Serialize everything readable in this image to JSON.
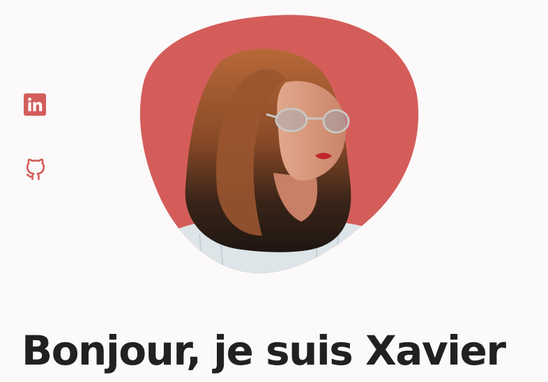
{
  "social": {
    "links": [
      {
        "name": "linkedin",
        "icon": "linkedin-icon"
      },
      {
        "name": "github",
        "icon": "github-icon"
      }
    ],
    "accent_color": "#d45d5a"
  },
  "hero": {
    "title": "Bonjour, je suis Xavier",
    "image_alt": "portrait-photo"
  },
  "colors": {
    "background": "#fcf9fa",
    "accent": "#d45d5a",
    "text": "#232021"
  }
}
